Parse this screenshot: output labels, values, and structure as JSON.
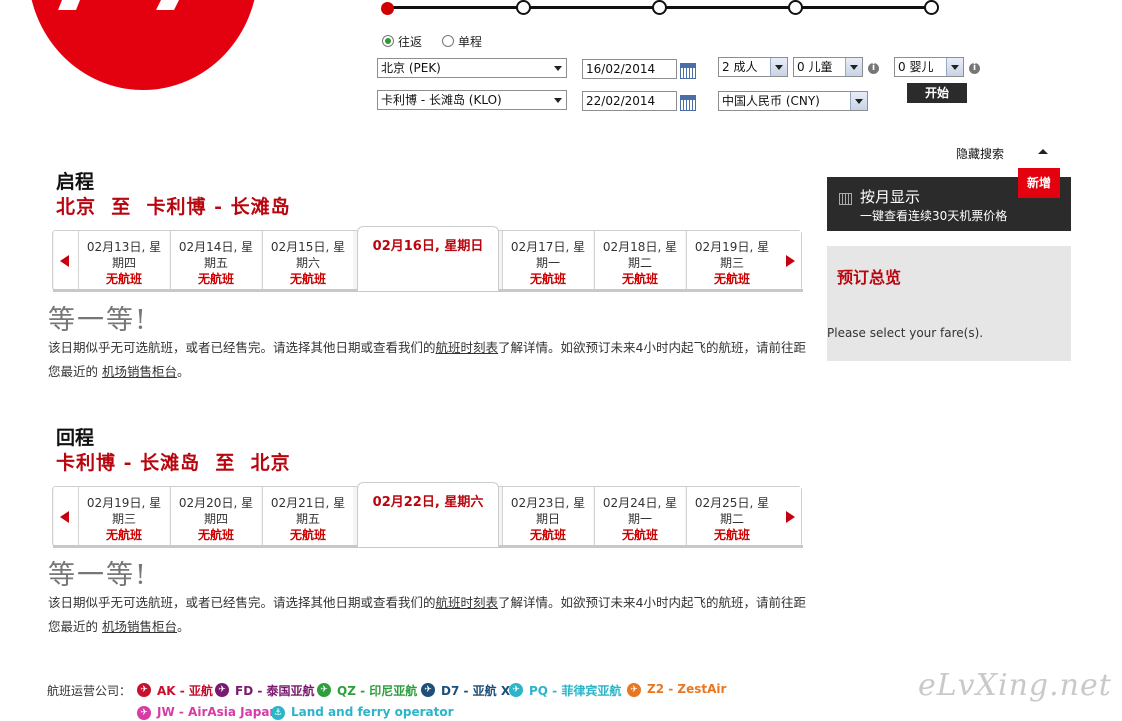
{
  "steps": [
    {
      "active": true
    },
    {
      "active": false
    },
    {
      "active": false
    },
    {
      "active": false
    },
    {
      "active": false
    }
  ],
  "search": {
    "trip_type": {
      "return": "往返",
      "oneway": "单程",
      "selected": "return"
    },
    "origin": "北京 (PEK)",
    "destination": "卡利博 - 长滩岛 (KLO)",
    "depart_date": "16/02/2014",
    "return_date": "22/02/2014",
    "adults": "2 成人",
    "children": "0 儿童",
    "infants": "0 婴儿",
    "currency": "中国人民币 (CNY)",
    "go_button": "开始",
    "hide_search": "隐藏搜索",
    "info_glyph": "i"
  },
  "outbound": {
    "label": "启程",
    "route": "北京  至  卡利博 - 长滩岛",
    "active_date": "02月16日, 星期日",
    "dates_before": [
      {
        "date": "02月13日, 星期四",
        "status": "无航班"
      },
      {
        "date": "02月14日, 星期五",
        "status": "无航班"
      },
      {
        "date": "02月15日, 星期六",
        "status": "无航班"
      }
    ],
    "dates_after": [
      {
        "date": "02月17日, 星期一",
        "status": "无航班"
      },
      {
        "date": "02月18日, 星期二",
        "status": "无航班"
      },
      {
        "date": "02月19日, 星期三",
        "status": "无航班"
      }
    ],
    "wait_title": "等一等!",
    "msg_prefix": "该日期似乎无可选航班，或者已经售完。请选择其他日期或查看我们的",
    "link_schedule": "航班时刻表",
    "msg_middle": "了解详情。如欲预订未来4小时内起飞的航班，请前往距您最近的 ",
    "link_counter": "机场销售柜台",
    "msg_end": "。"
  },
  "return": {
    "label": "回程",
    "route": "卡利博 - 长滩岛  至  北京",
    "active_date": "02月22日, 星期六",
    "dates_before": [
      {
        "date": "02月19日, 星期三",
        "status": "无航班"
      },
      {
        "date": "02月20日, 星期四",
        "status": "无航班"
      },
      {
        "date": "02月21日, 星期五",
        "status": "无航班"
      }
    ],
    "dates_after": [
      {
        "date": "02月23日, 星期日",
        "status": "无航班"
      },
      {
        "date": "02月24日, 星期一",
        "status": "无航班"
      },
      {
        "date": "02月25日, 星期二",
        "status": "无航班"
      }
    ],
    "wait_title": "等一等!",
    "msg_prefix": "该日期似乎无可选航班，或者已经售完。请选择其他日期或查看我们的",
    "link_schedule": "航班时刻表",
    "msg_middle": "了解详情。如欲预订未来4小时内起飞的航班，请前往距您最近的 ",
    "link_counter": "机场销售柜台",
    "msg_end": "。"
  },
  "sidebar": {
    "monthly_title": "按月显示",
    "monthly_sub": "一键查看连续30天机票价格",
    "new_badge": "新增",
    "summary_title": "预订总览",
    "summary_text": "Please select your fare(s)."
  },
  "airlines": {
    "label": "航班运营公司：",
    "items": [
      {
        "name": "AK - 亚航",
        "color": "#c8102e"
      },
      {
        "name": "FD - 泰国亚航",
        "color": "#7a1a6e"
      },
      {
        "name": "QZ - 印尼亚航",
        "color": "#2e9e3e"
      },
      {
        "name": "D7 - 亚航 X",
        "color": "#1d4f7a"
      },
      {
        "name": "PQ - 菲律宾亚航",
        "color": "#2bb5c9"
      },
      {
        "name": "Z2 - ZestAir",
        "color": "#e87722"
      },
      {
        "name": "JW - AirAsia Japan",
        "color": "#d63ba6"
      },
      {
        "name": "Land and ferry operator",
        "color": "#2bb5c9"
      }
    ]
  },
  "watermark": "eLvXing.net",
  "colors": {
    "brand_red": "#e3000f",
    "heading_red": "#b8060e"
  }
}
